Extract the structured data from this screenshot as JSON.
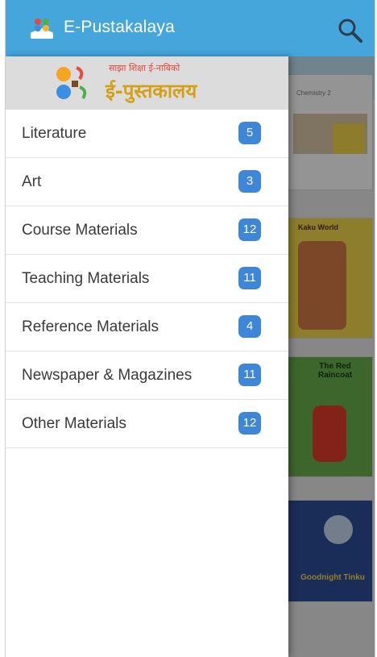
{
  "app_bar": {
    "title": "E-Pustakalaya",
    "icon": "app-logo-icon",
    "search_icon": "search-icon"
  },
  "drawer": {
    "banner": {
      "subtitle": "साझा शिक्षा ई-नाबिको",
      "title": "ई-पुस्तकालय"
    },
    "items": [
      {
        "label": "Literature",
        "count": "5"
      },
      {
        "label": "Art",
        "count": "3"
      },
      {
        "label": "Course Materials",
        "count": "12"
      },
      {
        "label": "Teaching Materials",
        "count": "11"
      },
      {
        "label": "Reference Materials",
        "count": "4"
      },
      {
        "label": "Newspaper & Magazines",
        "count": "11"
      },
      {
        "label": "Other Materials",
        "count": "12"
      }
    ]
  },
  "background_books": [
    {
      "title": "Chemistry 2"
    },
    {
      "title": "Kaku World"
    },
    {
      "title": "The Red Raincoat"
    },
    {
      "title": "Goodnight Tinku"
    }
  ],
  "colors": {
    "app_bar": "#45a6dc",
    "badge": "#3d86d8",
    "drawer_bg": "#ffffff",
    "banner_bg": "#dcdcdc"
  }
}
